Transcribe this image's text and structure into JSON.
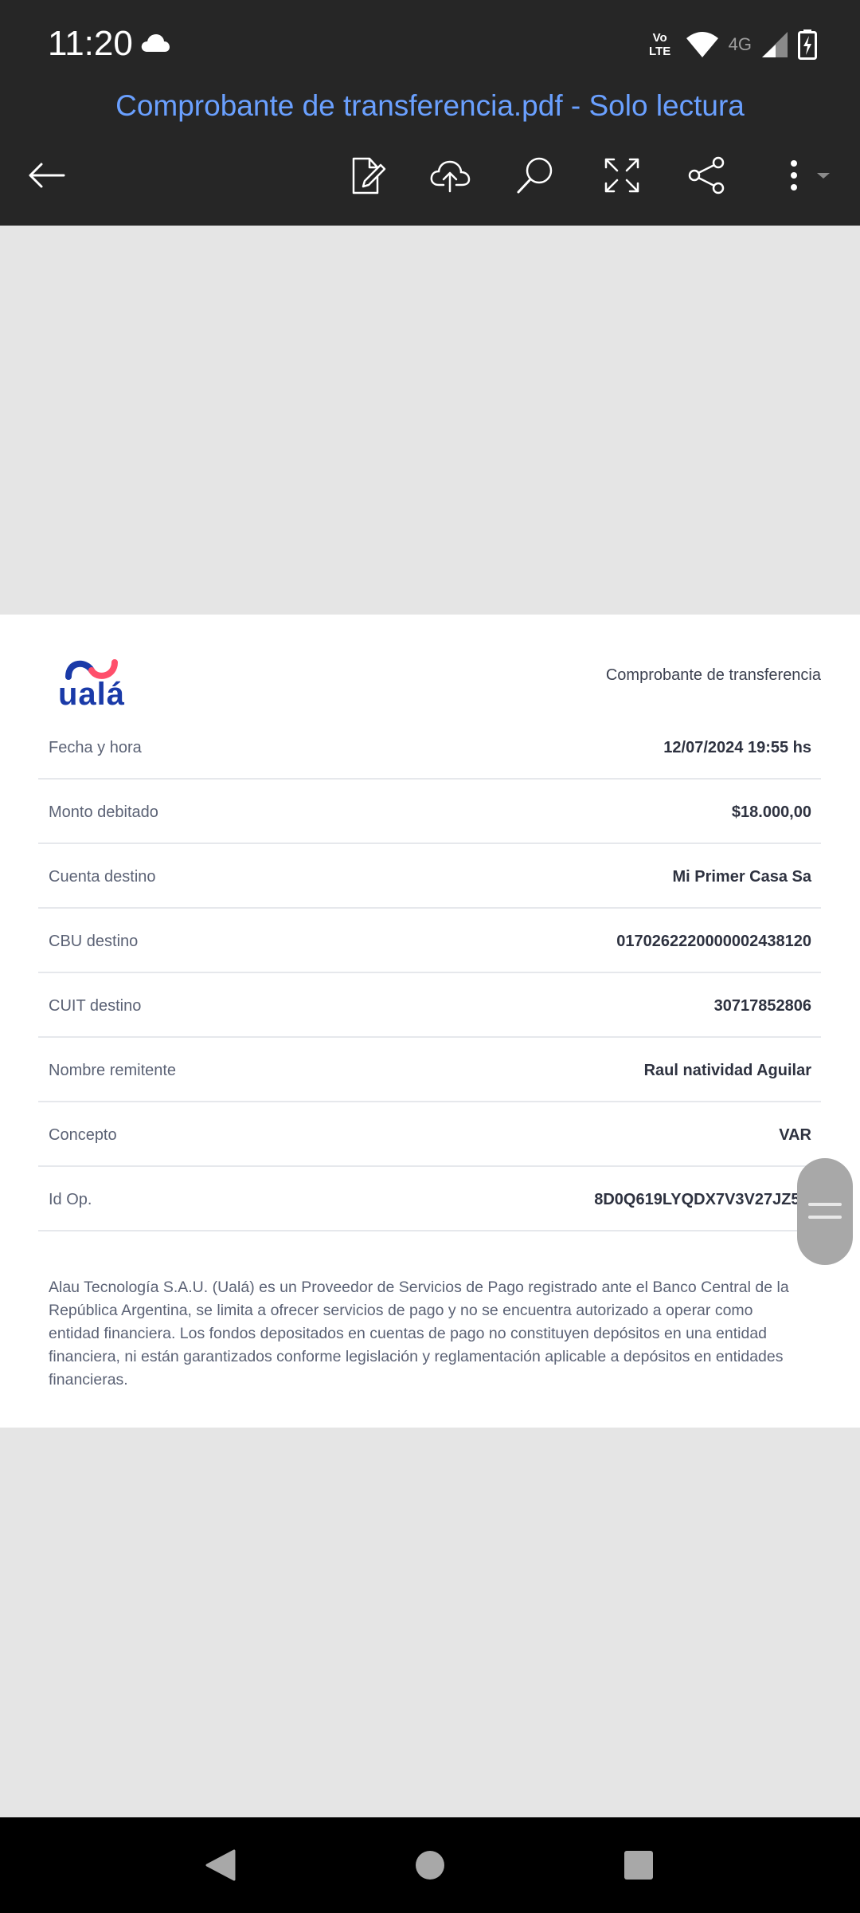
{
  "status_bar": {
    "time": "11:20",
    "volte": "Vo LTE",
    "network": "4G"
  },
  "viewer": {
    "title": "Comprobante de transferencia.pdf - Solo lectura",
    "icons": [
      "back-arrow-icon",
      "edit-icon",
      "cloud-upload-icon",
      "search-icon",
      "fullscreen-icon",
      "share-icon",
      "more-icon"
    ]
  },
  "receipt": {
    "logo_text": "ualá",
    "heading": "Comprobante de transferencia",
    "rows": [
      {
        "label": "Fecha y hora",
        "value": "12/07/2024 19:55 hs"
      },
      {
        "label": "Monto debitado",
        "value": "$18.000,00"
      },
      {
        "label": "Cuenta destino",
        "value": "Mi Primer Casa Sa"
      },
      {
        "label": "CBU destino",
        "value": "0170262220000002438120"
      },
      {
        "label": "CUIT destino",
        "value": "30717852806"
      },
      {
        "label": "Nombre remitente",
        "value": "Raul natividad Aguilar"
      },
      {
        "label": "Concepto",
        "value": "VAR"
      },
      {
        "label": "Id Op.",
        "value": "8D0Q619LYQDX7V3V27JZ5R"
      }
    ],
    "disclaimer": "Alau Tecnología S.A.U. (Ualá) es un Proveedor de Servicios de Pago registrado ante el Banco Central de la República Argentina, se limita a ofrecer servicios de pago y no se encuentra autorizado a operar como entidad financiera. Los fondos depositados en cuentas de pago no constituyen depósitos en una entidad financiera, ni están garantizados conforme legislación y reglamentación aplicable a depósitos en entidades financieras."
  },
  "colors": {
    "title": "#6aa0ff",
    "appbar": "#262626",
    "logo_blue": "#1a3aa8",
    "logo_red": "#ff4f6b"
  }
}
